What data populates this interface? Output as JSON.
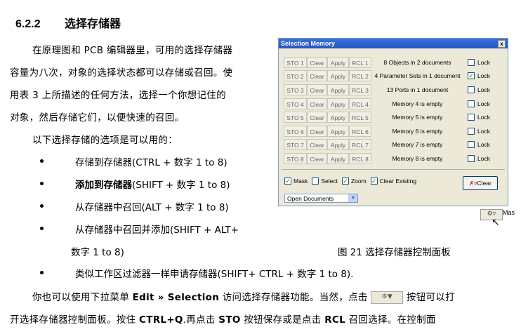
{
  "heading": {
    "number": "6.2.2",
    "title": "选择存储器"
  },
  "intro": {
    "line1": "在原理图和 PCB 编辑器里，可用的选择存储器",
    "line2": "容量为八次，对象的选择状态都可以存储或召回。使",
    "line3": "用表 3 上所描述的任何方法，选择一个你想记住的",
    "line4": "对象，然后存储它们，以便快速的召回。",
    "line5": "以下选择存储的选项是可以用的："
  },
  "bullets": [
    {
      "bold": "",
      "text": "存储到存储器(CTRL + 数字 1 to 8)"
    },
    {
      "bold": "添加到存储器",
      "text": "(SHIFT + 数字 1 to 8)"
    },
    {
      "bold": "",
      "text": "从存储器中召回(ALT + 数字 1 to 8)"
    },
    {
      "bold": "",
      "text": "从存储器中召回并添加(SHIFT + ALT+"
    }
  ],
  "bullet4_cont": "数字 1 to 8)",
  "figure_caption": "图 21 选择存储器控制面板",
  "bullet5": "类似工作区过滤器一样申请存储器(SHIFT+ CTRL + 数字 1 to 8).",
  "para2": {
    "p1": "你也可以使用下拉菜单 ",
    "menu": "Edit » Selection",
    "p2": " 访问选择存储器功能。当然，点击 ",
    "p3": " 按钮可以打",
    "l2a": "开选择存储器控制面板。按住 ",
    "key": "CTRL+Q",
    "l2b": ".再点击 ",
    "sto": "STO",
    "l2c": " 按钮保存或是点击 ",
    "rcl": "RCL",
    "l2d": " 召回选择。在控制面"
  },
  "dialog": {
    "title": "Selection Memory",
    "close": "x",
    "clear_label": "Clear",
    "apply_label": "Apply",
    "lock_label": "Lock",
    "rows": [
      {
        "sto": "STO 1",
        "rcl": "RCL 1",
        "text": "8 Objects in 2 documents",
        "locked": false
      },
      {
        "sto": "STO 2",
        "rcl": "RCL 2",
        "text": "4 Parameter Sets in 1 document",
        "locked": true
      },
      {
        "sto": "STO 3",
        "rcl": "RCL 3",
        "text": "13 Ports in 1 document",
        "locked": false
      },
      {
        "sto": "STO 4",
        "rcl": "RCL 4",
        "text": "Memory 4 is empty",
        "locked": false
      },
      {
        "sto": "STO 5",
        "rcl": "RCL 5",
        "text": "Memory 5 is empty",
        "locked": false
      },
      {
        "sto": "STO 6",
        "rcl": "RCL 6",
        "text": "Memory 6 is empty",
        "locked": false
      },
      {
        "sto": "STO 7",
        "rcl": "RCL 7",
        "text": "Memory 7 is empty",
        "locked": false
      },
      {
        "sto": "STO 8",
        "rcl": "RCL 8",
        "text": "Memory 8 is empty",
        "locked": false
      }
    ],
    "options": {
      "mask": "Mask",
      "select": "Select",
      "zoom": "Zoom",
      "clear_existing": "Clear Existing"
    },
    "clear_button": "Clear",
    "scope_selected": "Open Documents"
  },
  "mask_button_label": "Mas",
  "colors": {
    "titlebar": "#2456c4",
    "dialog_bg": "#ece9d8",
    "check": "#1a7f1a"
  }
}
